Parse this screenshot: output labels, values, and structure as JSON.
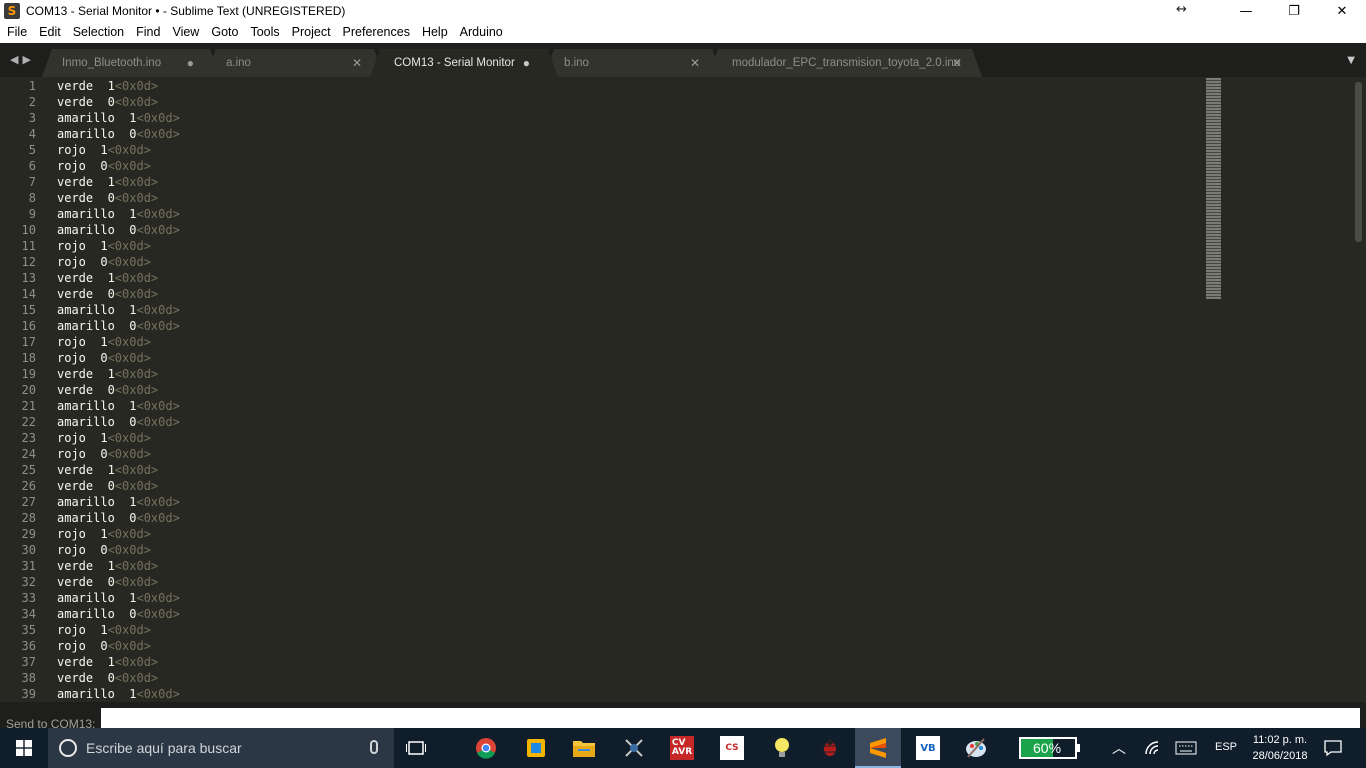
{
  "window": {
    "title": "COM13 - Serial Monitor • - Sublime Text (UNREGISTERED)",
    "app_icon": "sublime-text-icon",
    "controls": [
      "minimize",
      "maximize",
      "close"
    ]
  },
  "menu": [
    "File",
    "Edit",
    "Selection",
    "Find",
    "View",
    "Goto",
    "Tools",
    "Project",
    "Preferences",
    "Help",
    "Arduino"
  ],
  "tabs": [
    {
      "label": "Inmo_Bluetooth.ino",
      "control": "●",
      "active": false
    },
    {
      "label": "a.ino",
      "control": "✕",
      "active": false
    },
    {
      "label": "COM13 - Serial Monitor",
      "control": "●",
      "active": true
    },
    {
      "label": "b.ino",
      "control": "✕",
      "active": false
    },
    {
      "label": "modulador_EPC_transmision_toyota_2.0.ino",
      "control": "✕",
      "active": false
    }
  ],
  "editor": {
    "lines": [
      {
        "n": "1",
        "text": "verde  1",
        "cr": "<0x0d>"
      },
      {
        "n": "2",
        "text": "verde  0",
        "cr": "<0x0d>"
      },
      {
        "n": "3",
        "text": "amarillo  1",
        "cr": "<0x0d>"
      },
      {
        "n": "4",
        "text": "amarillo  0",
        "cr": "<0x0d>"
      },
      {
        "n": "5",
        "text": "rojo  1",
        "cr": "<0x0d>"
      },
      {
        "n": "6",
        "text": "rojo  0",
        "cr": "<0x0d>"
      },
      {
        "n": "7",
        "text": "verde  1",
        "cr": "<0x0d>"
      },
      {
        "n": "8",
        "text": "verde  0",
        "cr": "<0x0d>"
      },
      {
        "n": "9",
        "text": "amarillo  1",
        "cr": "<0x0d>"
      },
      {
        "n": "10",
        "text": "amarillo  0",
        "cr": "<0x0d>"
      },
      {
        "n": "11",
        "text": "rojo  1",
        "cr": "<0x0d>"
      },
      {
        "n": "12",
        "text": "rojo  0",
        "cr": "<0x0d>"
      },
      {
        "n": "13",
        "text": "verde  1",
        "cr": "<0x0d>"
      },
      {
        "n": "14",
        "text": "verde  0",
        "cr": "<0x0d>"
      },
      {
        "n": "15",
        "text": "amarillo  1",
        "cr": "<0x0d>"
      },
      {
        "n": "16",
        "text": "amarillo  0",
        "cr": "<0x0d>"
      },
      {
        "n": "17",
        "text": "rojo  1",
        "cr": "<0x0d>"
      },
      {
        "n": "18",
        "text": "rojo  0",
        "cr": "<0x0d>"
      },
      {
        "n": "19",
        "text": "verde  1",
        "cr": "<0x0d>"
      },
      {
        "n": "20",
        "text": "verde  0",
        "cr": "<0x0d>"
      },
      {
        "n": "21",
        "text": "amarillo  1",
        "cr": "<0x0d>"
      },
      {
        "n": "22",
        "text": "amarillo  0",
        "cr": "<0x0d>"
      },
      {
        "n": "23",
        "text": "rojo  1",
        "cr": "<0x0d>"
      },
      {
        "n": "24",
        "text": "rojo  0",
        "cr": "<0x0d>"
      },
      {
        "n": "25",
        "text": "verde  1",
        "cr": "<0x0d>"
      },
      {
        "n": "26",
        "text": "verde  0",
        "cr": "<0x0d>"
      },
      {
        "n": "27",
        "text": "amarillo  1",
        "cr": "<0x0d>"
      },
      {
        "n": "28",
        "text": "amarillo  0",
        "cr": "<0x0d>"
      },
      {
        "n": "29",
        "text": "rojo  1",
        "cr": "<0x0d>"
      },
      {
        "n": "30",
        "text": "rojo  0",
        "cr": "<0x0d>"
      },
      {
        "n": "31",
        "text": "verde  1",
        "cr": "<0x0d>"
      },
      {
        "n": "32",
        "text": "verde  0",
        "cr": "<0x0d>"
      },
      {
        "n": "33",
        "text": "amarillo  1",
        "cr": "<0x0d>"
      },
      {
        "n": "34",
        "text": "amarillo  0",
        "cr": "<0x0d>"
      },
      {
        "n": "35",
        "text": "rojo  1",
        "cr": "<0x0d>"
      },
      {
        "n": "36",
        "text": "rojo  0",
        "cr": "<0x0d>"
      },
      {
        "n": "37",
        "text": "verde  1",
        "cr": "<0x0d>"
      },
      {
        "n": "38",
        "text": "verde  0",
        "cr": "<0x0d>"
      },
      {
        "n": "39",
        "text": "amarillo  1",
        "cr": "<0x0d>"
      }
    ]
  },
  "input_panel": {
    "label": "Send to COM13:",
    "value": ""
  },
  "taskbar": {
    "search_placeholder": "Escribe aquí para buscar",
    "battery_percent": "60%",
    "battery_level": 0.6,
    "language": "ESP",
    "time": "11:02 p. m.",
    "date": "28/06/2018",
    "pinned_icons": [
      "task-view-icon",
      "chrome-icon",
      "app-icon",
      "file-explorer-icon",
      "network-tool-icon",
      "cvavr-icon",
      "codevision-icon",
      "lightbulb-icon",
      "bug-icon",
      "sublime-text-icon",
      "vb-icon",
      "paint-icon"
    ]
  }
}
